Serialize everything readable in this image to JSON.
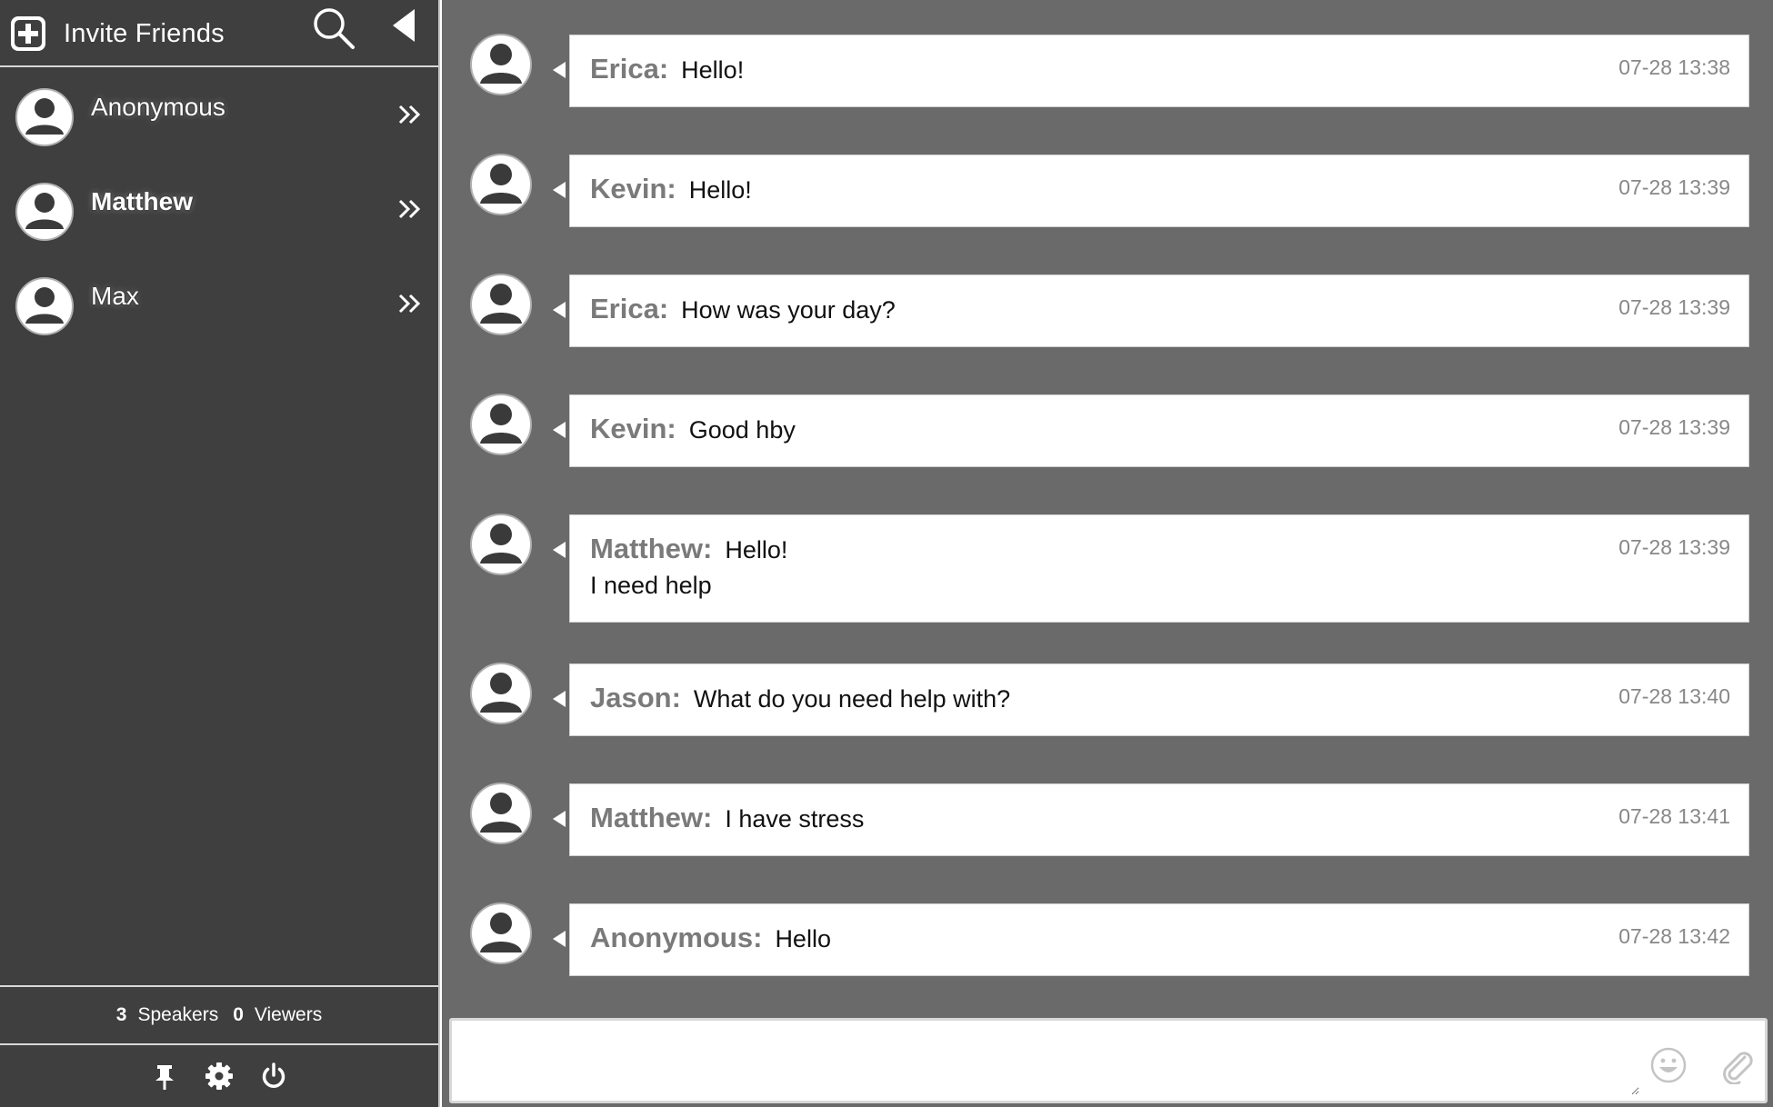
{
  "sidebar": {
    "invite_label": "Invite Friends",
    "users": [
      {
        "name": "Anonymous",
        "bold": false
      },
      {
        "name": "Matthew",
        "bold": true
      },
      {
        "name": "Max",
        "bold": false
      }
    ],
    "stats": {
      "speakers_count": "3",
      "speakers_label": "Speakers",
      "viewers_count": "0",
      "viewers_label": "Viewers"
    },
    "toolbar_icons": [
      "pin-icon",
      "gear-icon",
      "power-icon"
    ]
  },
  "messages": [
    {
      "author": "Erica:",
      "lines": [
        "Hello!"
      ],
      "time": "07-28 13:38"
    },
    {
      "author": "Kevin:",
      "lines": [
        "Hello!"
      ],
      "time": "07-28 13:39"
    },
    {
      "author": "Erica:",
      "lines": [
        "How was your day?"
      ],
      "time": "07-28 13:39"
    },
    {
      "author": "Kevin:",
      "lines": [
        "Good hby"
      ],
      "time": "07-28 13:39"
    },
    {
      "author": "Matthew:",
      "lines": [
        "Hello!",
        "I need help"
      ],
      "time": "07-28 13:39"
    },
    {
      "author": "Jason:",
      "lines": [
        "What do you need help with?"
      ],
      "time": "07-28 13:40"
    },
    {
      "author": "Matthew:",
      "lines": [
        "I have stress"
      ],
      "time": "07-28 13:41"
    },
    {
      "author": "Anonymous:",
      "lines": [
        "Hello"
      ],
      "time": "07-28 13:42"
    }
  ],
  "composer": {
    "value": "",
    "placeholder": ""
  },
  "colors": {
    "sidebar_bg": "#3f3f3f",
    "chat_bg": "#6b6a6b",
    "bubble_bg": "#ffffff",
    "author_text": "#7a7a7a",
    "timestamp_text": "#888888"
  }
}
